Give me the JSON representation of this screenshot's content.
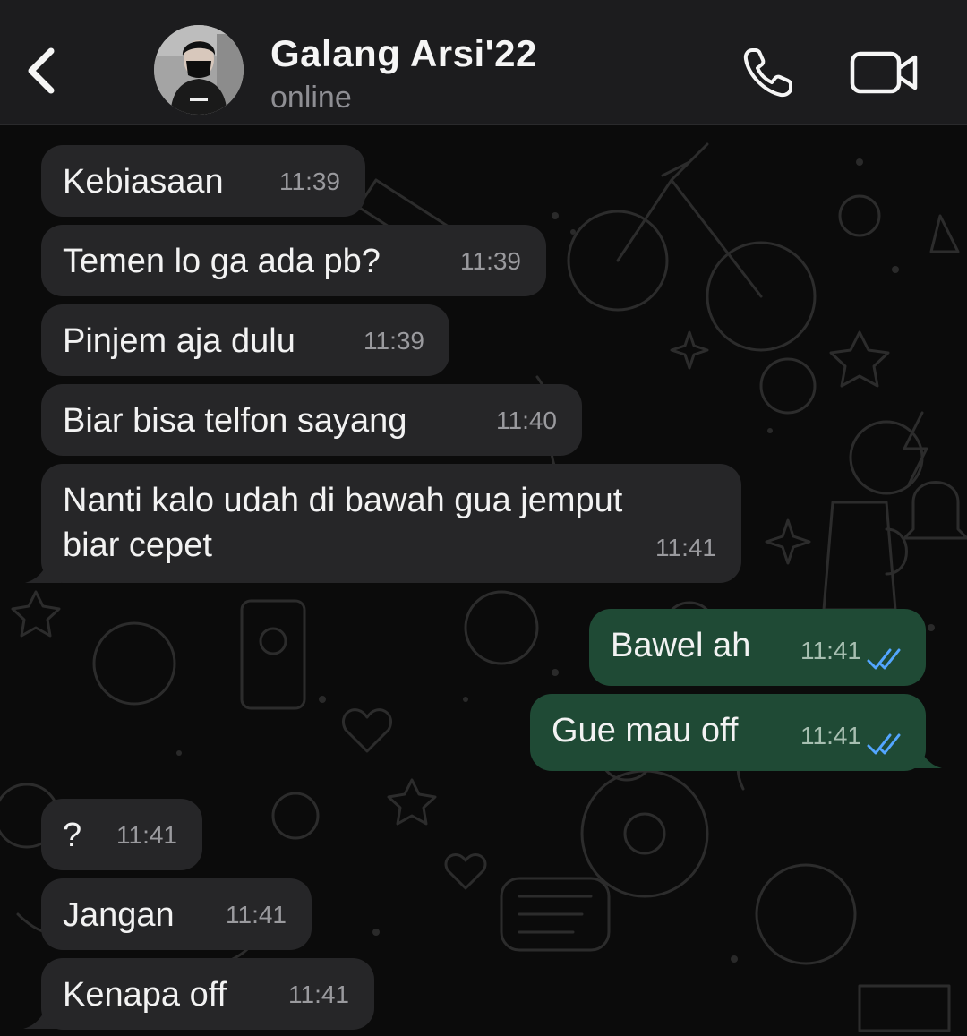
{
  "header": {
    "contact_name": "Galang Arsi'22",
    "status": "online"
  },
  "colors": {
    "incoming_bubble": "#262628",
    "outgoing_bubble": "#1f4a35",
    "read_ticks": "#53a6ff",
    "header_bg": "#1c1c1e"
  },
  "icons": {
    "back": "chevron-left-icon",
    "call": "phone-icon",
    "video": "video-camera-icon",
    "read": "double-check-icon"
  },
  "messages": [
    {
      "direction": "in",
      "text": "Kebiasaan",
      "time": "11:39"
    },
    {
      "direction": "in",
      "text": "Temen lo ga ada pb?",
      "time": "11:39"
    },
    {
      "direction": "in",
      "text": "Pinjem aja dulu",
      "time": "11:39"
    },
    {
      "direction": "in",
      "text": "Biar bisa telfon sayang",
      "time": "11:40"
    },
    {
      "direction": "in",
      "text_line1": "Nanti kalo udah di bawah gua jemput",
      "text_line2": "biar cepet",
      "time": "11:41"
    },
    {
      "direction": "out",
      "text": "Bawel ah",
      "time": "11:41",
      "status": "read"
    },
    {
      "direction": "out",
      "text": "Gue mau off",
      "time": "11:41",
      "status": "read"
    },
    {
      "direction": "in",
      "text": "?",
      "time": "11:41"
    },
    {
      "direction": "in",
      "text": "Jangan",
      "time": "11:41"
    },
    {
      "direction": "in",
      "text": "Kenapa off",
      "time": "11:41"
    }
  ]
}
